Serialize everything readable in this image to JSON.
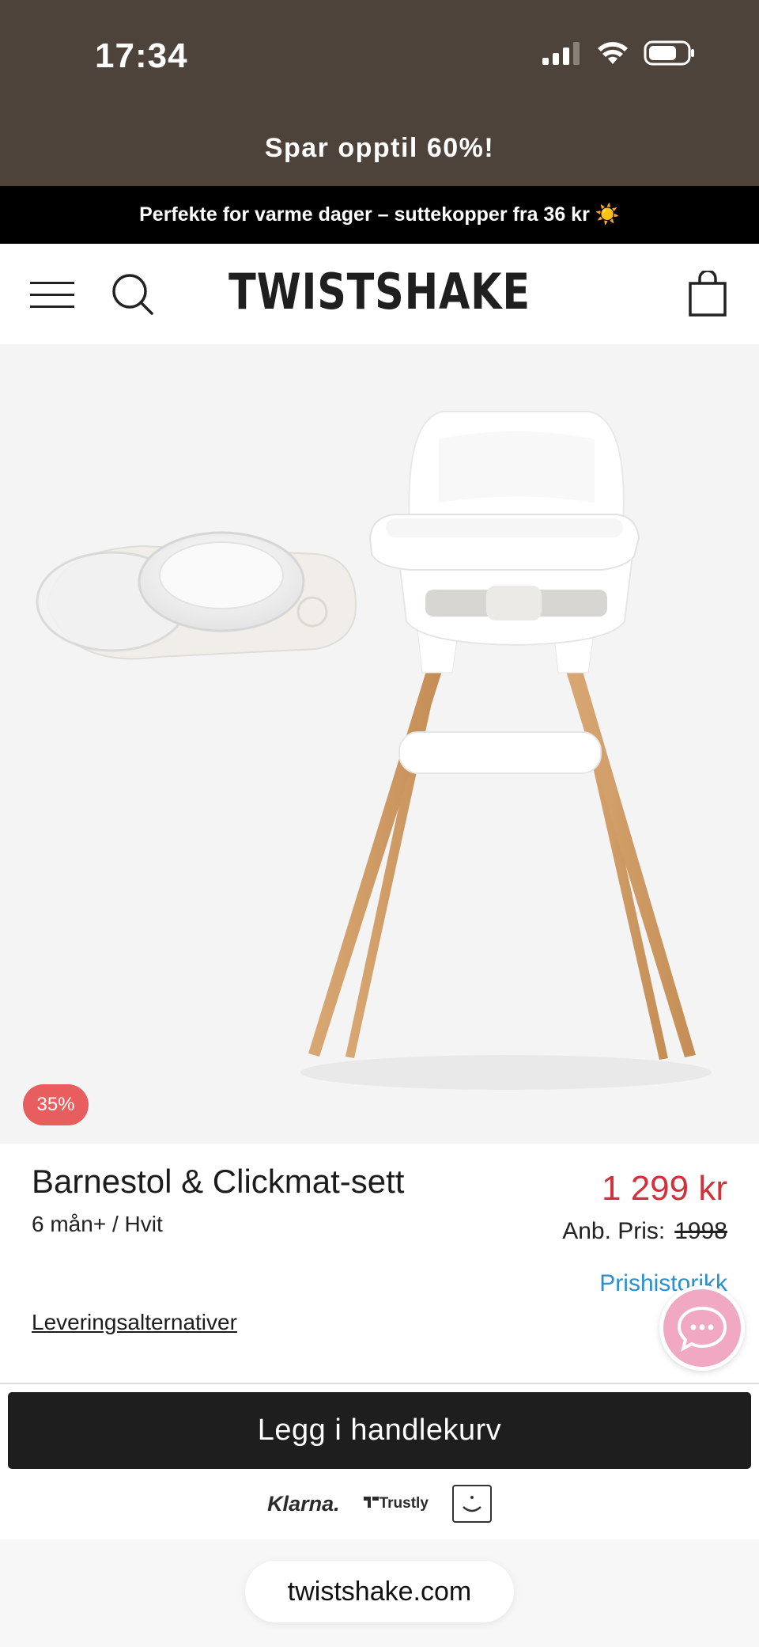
{
  "status_bar": {
    "time": "17:34"
  },
  "promo": {
    "text": "Spar opptil 60%!"
  },
  "announcement": {
    "text": "Perfekte for varme dager – suttekopper fra 36 kr ☀️"
  },
  "header": {
    "logo": "TWISTSHAKE"
  },
  "product": {
    "discount_badge": "35%",
    "title": "Barnestol & Clickmat-sett",
    "variant": "6 mån+ / Hvit",
    "price": "1 299 kr",
    "ref_price_label": "Anb. Pris:",
    "ref_price_value": "1998",
    "price_history_link": "Prishistorikk",
    "delivery_link": "Leveringsalternativer"
  },
  "actions": {
    "add_to_cart_label": "Legg i handlekurv"
  },
  "payment": {
    "klarna": "Klarna.",
    "trustly": "Trustly"
  },
  "browser": {
    "url": "twistshake.com"
  },
  "colors": {
    "brand_bar": "#4d433a",
    "announcement_bg": "#000000",
    "price_red": "#d3303a",
    "badge_red": "#e85e5e",
    "link_blue": "#2a8fd1",
    "chat_pink": "#f1a9c3",
    "button_dark": "#1e1e1e"
  }
}
